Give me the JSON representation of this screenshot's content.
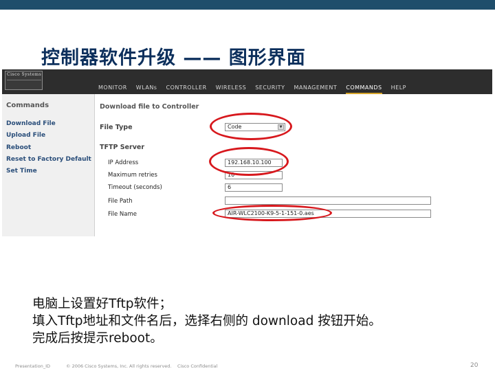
{
  "slide": {
    "title": "控制器软件升级 —— 图形界面",
    "notes": [
      "电脑上设置好Tftp软件；",
      "填入Tftp地址和文件名后，选择右侧的 download 按钮开始。",
      "完成后按提示reboot。"
    ],
    "footer": {
      "left": "Presentation_ID",
      "copyright": "© 2006 Cisco Systems, Inc. All rights reserved.",
      "confidential": "Cisco Confidential",
      "page": "20"
    },
    "colors": {
      "top_bar": "#1f4e6b",
      "title": "#0c2f5c",
      "highlight": "#d7181d"
    }
  },
  "app": {
    "logo_text": "Cisco Systems",
    "nav": [
      "MONITOR",
      "WLANs",
      "CONTROLLER",
      "WIRELESS",
      "SECURITY",
      "MANAGEMENT",
      "COMMANDS",
      "HELP"
    ],
    "active_nav": "COMMANDS",
    "sidebar": {
      "heading": "Commands",
      "items": [
        "Download File",
        "Upload File",
        "Reboot",
        "Reset to Factory Default",
        "Set Time"
      ]
    },
    "form": {
      "title": "Download file to Controller",
      "file_type_label": "File Type",
      "file_type_value": "Code",
      "tftp_heading": "TFTP Server",
      "ip_label": "IP Address",
      "ip_value": "192.168.10.100",
      "retries_label": "Maximum retries",
      "retries_value": "10",
      "timeout_label": "Timeout (seconds)",
      "timeout_value": "6",
      "path_label": "File Path",
      "path_value": "",
      "name_label": "File Name",
      "name_value": "AIR-WLC2100-K9-5-1-151-0.aes"
    }
  }
}
